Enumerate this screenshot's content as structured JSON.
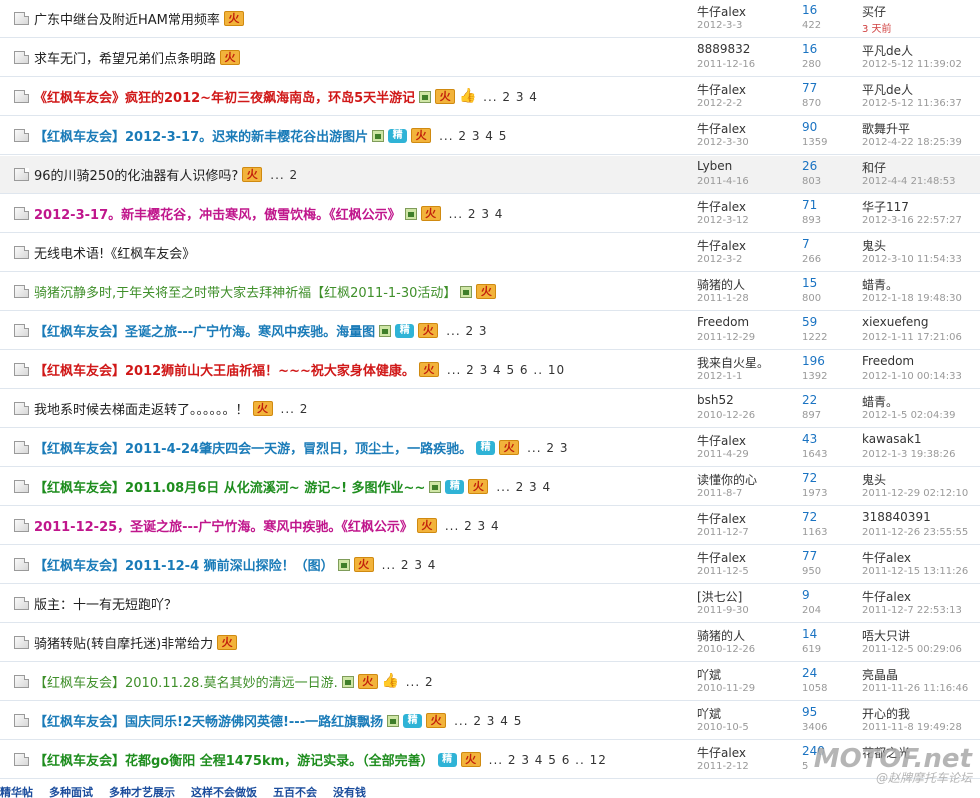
{
  "threads": [
    {
      "title": "广东中继台及附近HAM常用频率",
      "style": "plain",
      "badges": [
        "fire"
      ],
      "pages": "",
      "author": "牛仔alex",
      "date": "2012-3-3",
      "replies": "16",
      "views": "422",
      "last_user": "买仔",
      "last_time": "3 天前",
      "last_red": true
    },
    {
      "title": "求车无门，希望兄弟们点条明路",
      "style": "plain",
      "badges": [
        "fire"
      ],
      "pages": "",
      "author": "8889832",
      "date": "2011-12-16",
      "replies": "16",
      "views": "280",
      "last_user": "平凡de人",
      "last_time": "2012-5-12 11:39:02",
      "last_red": false
    },
    {
      "title": "《红枫车友会》疯狂的2012~年初三夜飙海南岛，环岛5天半游记",
      "style": "red",
      "badges": [
        "img",
        "fire",
        "thumb"
      ],
      "pages": "... 2 3 4",
      "author": "牛仔alex",
      "date": "2012-2-2",
      "replies": "77",
      "views": "870",
      "last_user": "平凡de人",
      "last_time": "2012-5-12 11:36:37",
      "last_red": false
    },
    {
      "title": "【红枫车友会】2012-3-17。迟来的新丰樱花谷出游图片",
      "style": "blue",
      "badges": [
        "img",
        "jing",
        "fire"
      ],
      "pages": "... 2 3 4 5",
      "author": "牛仔alex",
      "date": "2012-3-30",
      "replies": "90",
      "views": "1359",
      "last_user": "歌舞升平",
      "last_time": "2012-4-22 18:25:39",
      "last_red": false
    },
    {
      "title": "96的川骑250的化油器有人识修吗?",
      "style": "plain",
      "badges": [
        "fire"
      ],
      "pages": "... 2",
      "author": "Lyben",
      "date": "2011-4-16",
      "replies": "26",
      "views": "803",
      "last_user": "和仔",
      "last_time": "2012-4-4 21:48:53",
      "last_red": false,
      "highlight": true
    },
    {
      "title": "2012-3-17。新丰樱花谷，冲击寒风，傲雪饮梅。《红枫公示》",
      "style": "purple",
      "badges": [
        "img",
        "fire"
      ],
      "pages": "... 2 3 4",
      "author": "牛仔alex",
      "date": "2012-3-12",
      "replies": "71",
      "views": "893",
      "last_user": "华子117",
      "last_time": "2012-3-16 22:57:27",
      "last_red": false
    },
    {
      "title": "无线电术语!《红枫车友会》",
      "style": "plain",
      "badges": [],
      "pages": "",
      "author": "牛仔alex",
      "date": "2012-3-2",
      "replies": "7",
      "views": "266",
      "last_user": "鬼头",
      "last_time": "2012-3-10 11:54:33",
      "last_red": false
    },
    {
      "title": "骑猪沉静多时,于年关将至之时带大家去拜神祈福【红枫2011-1-30活动】",
      "style": "green",
      "badges": [
        "img",
        "fire"
      ],
      "pages": "",
      "author": "骑猪的人",
      "date": "2011-1-28",
      "replies": "15",
      "views": "800",
      "last_user": "蜡青。",
      "last_time": "2012-1-18 19:48:30",
      "last_red": false
    },
    {
      "title": "【红枫车友会】圣诞之旅---广宁竹海。寒风中疾驰。海量图",
      "style": "blue",
      "badges": [
        "img",
        "jing",
        "fire"
      ],
      "pages": "... 2 3",
      "author": "Freedom",
      "date": "2011-12-29",
      "replies": "59",
      "views": "1222",
      "last_user": "xiexuefeng",
      "last_time": "2012-1-11 17:21:06",
      "last_red": false
    },
    {
      "title": "【红枫车友会】2012狮前山大王庙祈福！~~~祝大家身体健康。",
      "style": "red",
      "badges": [
        "fire"
      ],
      "pages": "... 2 3 4 5 6 .. 10",
      "author": "我来自火星。",
      "date": "2012-1-1",
      "replies": "196",
      "views": "1392",
      "last_user": "Freedom",
      "last_time": "2012-1-10 00:14:33",
      "last_red": false
    },
    {
      "title": "我地系时候去梯面走返转了。。。。。。！",
      "style": "plain",
      "badges": [
        "fire"
      ],
      "pages": "... 2",
      "author": "bsh52",
      "date": "2010-12-26",
      "replies": "22",
      "views": "897",
      "last_user": "蜡青。",
      "last_time": "2012-1-5 02:04:39",
      "last_red": false
    },
    {
      "title": "【红枫车友会】2011-4-24肇庆四会一天游，冒烈日，顶尘土，一路疾驰。",
      "style": "blue",
      "badges": [
        "jing",
        "fire"
      ],
      "pages": "... 2 3",
      "author": "牛仔alex",
      "date": "2011-4-29",
      "replies": "43",
      "views": "1643",
      "last_user": "kawasak1",
      "last_time": "2012-1-3 19:38:26",
      "last_red": false
    },
    {
      "title": "【红枫车友会】2011.08月6日 从化流溪河~ 游记~! 多图作业~~",
      "style": "dgreen",
      "badges": [
        "img",
        "jing",
        "fire"
      ],
      "pages": "... 2 3 4",
      "author": "读懂你的心",
      "date": "2011-8-7",
      "replies": "72",
      "views": "1973",
      "last_user": "鬼头",
      "last_time": "2011-12-29 02:12:10",
      "last_red": false
    },
    {
      "title": "2011-12-25，圣诞之旅---广宁竹海。寒风中疾驰。《红枫公示》",
      "style": "purple",
      "badges": [
        "fire"
      ],
      "pages": "... 2 3 4",
      "author": "牛仔alex",
      "date": "2011-12-7",
      "replies": "72",
      "views": "1163",
      "last_user": "318840391",
      "last_time": "2011-12-26 23:55:55",
      "last_red": false
    },
    {
      "title": "【红枫车友会】2011-12-4 狮前深山探险！（图）",
      "style": "blue",
      "badges": [
        "img",
        "fire"
      ],
      "pages": "... 2 3 4",
      "author": "牛仔alex",
      "date": "2011-12-5",
      "replies": "77",
      "views": "950",
      "last_user": "牛仔alex",
      "last_time": "2011-12-15 13:11:26",
      "last_red": false
    },
    {
      "title": "版主：十一有无短跑吖？",
      "style": "plain",
      "badges": [],
      "pages": "",
      "author": "[洪七公]",
      "date": "2011-9-30",
      "replies": "9",
      "views": "204",
      "last_user": "牛仔alex",
      "last_time": "2011-12-7 22:53:13",
      "last_red": false
    },
    {
      "title": "骑猪转贴(转自摩托迷)非常给力",
      "style": "plain",
      "badges": [
        "fire"
      ],
      "pages": "",
      "author": "骑猪的人",
      "date": "2010-12-26",
      "replies": "14",
      "views": "619",
      "last_user": "唔大只讲",
      "last_time": "2011-12-5 00:29:06",
      "last_red": false
    },
    {
      "title": "【红枫车友会】2010.11.28.莫名其妙的清远一日游.",
      "style": "green",
      "badges": [
        "img",
        "fire",
        "thumb"
      ],
      "pages": "... 2",
      "author": "吖斌",
      "date": "2010-11-29",
      "replies": "24",
      "views": "1058",
      "last_user": "亮晶晶",
      "last_time": "2011-11-26 11:16:46",
      "last_red": false
    },
    {
      "title": "【红枫车友会】国庆同乐!2天畅游佛冈英德!---一路红旗飘扬",
      "style": "blue",
      "badges": [
        "img",
        "jing",
        "fire"
      ],
      "pages": "... 2 3 4 5",
      "author": "吖斌",
      "date": "2010-10-5",
      "replies": "95",
      "views": "3406",
      "last_user": "开心的我",
      "last_time": "2011-11-8 19:49:28",
      "last_red": false
    },
    {
      "title": "【红枫车友会】花都go衡阳 全程1475km，游记实录。（全部完善）",
      "style": "dgreen",
      "badges": [
        "jing",
        "fire"
      ],
      "pages": "... 2 3 4 5 6 .. 12",
      "author": "牛仔alex",
      "date": "2011-2-12",
      "replies": "240",
      "views": "5",
      "last_user": "花都之光",
      "last_time": "",
      "last_red": false
    }
  ],
  "badge_text": {
    "fire": "火",
    "jing": "精",
    "thumb": "👍"
  },
  "footer_links": [
    "精华帖",
    "多种面试",
    "多种才艺展示",
    "这样不会做饭",
    "五百不会",
    "没有钱"
  ],
  "watermark": {
    "main": "MOTOF.net",
    "sub": "@赵牌摩托车论坛"
  }
}
